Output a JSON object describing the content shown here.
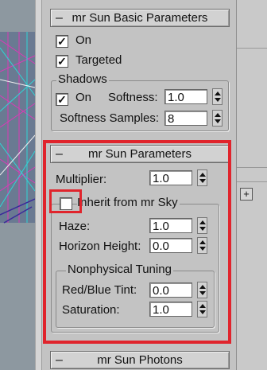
{
  "basic": {
    "title": "mr Sun Basic Parameters",
    "on_label": "On",
    "on_checked": "✓",
    "targeted_label": "Targeted",
    "targeted_checked": "✓",
    "shadows_title": "Shadows",
    "shadows_on_label": "On",
    "shadows_on_checked": "✓",
    "softness_label": "Softness:",
    "softness_value": "1.0",
    "samples_label": "Softness Samples:",
    "samples_value": "8"
  },
  "params": {
    "title": "mr Sun Parameters",
    "multiplier_label": "Multiplier:",
    "multiplier_value": "1.0",
    "inherit_label": "Inherit from mr Sky",
    "haze_label": "Haze:",
    "haze_value": "1.0",
    "horizon_label": "Horizon Height:",
    "horizon_value": "0.0",
    "nonphysical_title": "Nonphysical Tuning",
    "tint_label": "Red/Blue Tint:",
    "tint_value": "0.0",
    "saturation_label": "Saturation:",
    "saturation_value": "1.0"
  },
  "photons": {
    "title": "mr Sun Photons"
  },
  "colors": {
    "highlight": "#e0242c"
  }
}
